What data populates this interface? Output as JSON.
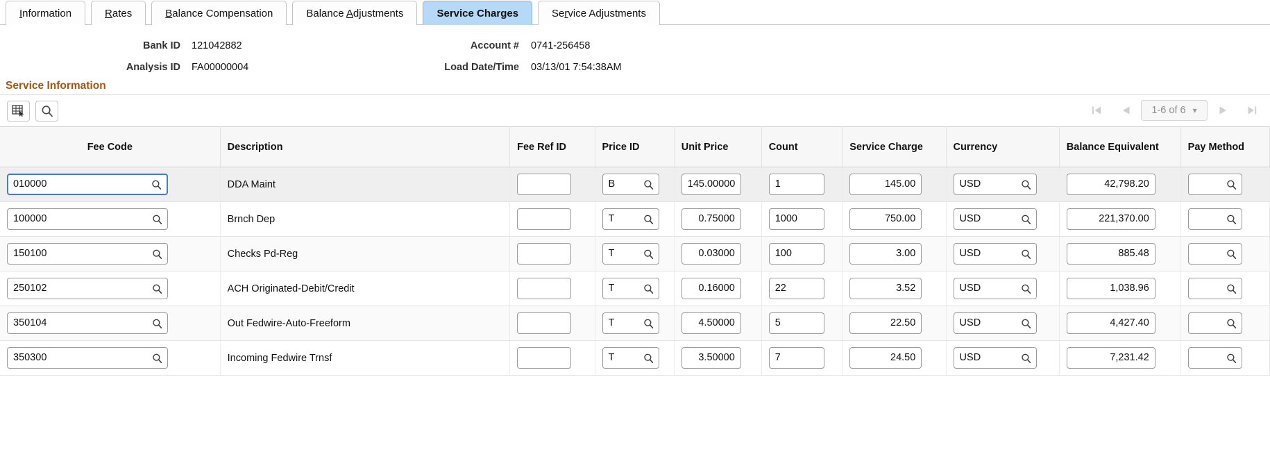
{
  "tabs": [
    {
      "label": "Information",
      "accel": "I",
      "active": false
    },
    {
      "label": "Rates",
      "accel": "R",
      "active": false
    },
    {
      "label": "Balance Compensation",
      "accel": "B",
      "active": false
    },
    {
      "label": "Balance Adjustments",
      "accel": "A",
      "active": false
    },
    {
      "label": "Service Charges",
      "accel": "",
      "active": true
    },
    {
      "label": "Service Adjustments",
      "accel": "r",
      "active": false
    }
  ],
  "header": {
    "bank_id_label": "Bank ID",
    "bank_id_value": "121042882",
    "analysis_id_label": "Analysis ID",
    "analysis_id_value": "FA00000004",
    "account_label": "Account #",
    "account_value": "0741-256458",
    "load_date_label": "Load Date/Time",
    "load_date_value": "03/13/01  7:54:38AM"
  },
  "section": {
    "title": "Service Information",
    "accent_color": "#a85412"
  },
  "toolbar": {
    "personalize_icon": "grid-personalize-icon",
    "find_icon": "search-icon"
  },
  "pager": {
    "first_icon": "first-page-icon",
    "prev_icon": "previous-page-icon",
    "range_label": "1-6 of 6",
    "chevron_icon": "chevron-down-icon",
    "next_icon": "next-page-icon",
    "last_icon": "last-page-icon"
  },
  "columns": [
    {
      "key": "fee_code",
      "label": "Fee Code",
      "align": "center"
    },
    {
      "key": "description",
      "label": "Description",
      "align": "left"
    },
    {
      "key": "fee_ref_id",
      "label": "Fee Ref ID",
      "align": "left"
    },
    {
      "key": "price_id",
      "label": "Price ID",
      "align": "left"
    },
    {
      "key": "unit_price",
      "label": "Unit Price",
      "align": "left"
    },
    {
      "key": "count",
      "label": "Count",
      "align": "left"
    },
    {
      "key": "service_charge",
      "label": "Service Charge",
      "align": "left"
    },
    {
      "key": "currency",
      "label": "Currency",
      "align": "left"
    },
    {
      "key": "balance_equivalent",
      "label": "Balance Equivalent",
      "align": "left"
    },
    {
      "key": "pay_method",
      "label": "Pay Method",
      "align": "left"
    }
  ],
  "rows": [
    {
      "fee_code": "010000",
      "description": "DDA Maint",
      "fee_ref_id": "",
      "price_id": "B",
      "unit_price": "145.00000",
      "count": "1",
      "service_charge": "145.00",
      "currency": "USD",
      "balance_equivalent": "42,798.20",
      "pay_method": ""
    },
    {
      "fee_code": "100000",
      "description": "Brnch Dep",
      "fee_ref_id": "",
      "price_id": "T",
      "unit_price": "0.75000",
      "count": "1000",
      "service_charge": "750.00",
      "currency": "USD",
      "balance_equivalent": "221,370.00",
      "pay_method": ""
    },
    {
      "fee_code": "150100",
      "description": "Checks Pd-Reg",
      "fee_ref_id": "",
      "price_id": "T",
      "unit_price": "0.03000",
      "count": "100",
      "service_charge": "3.00",
      "currency": "USD",
      "balance_equivalent": "885.48",
      "pay_method": ""
    },
    {
      "fee_code": "250102",
      "description": "ACH Originated-Debit/Credit",
      "fee_ref_id": "",
      "price_id": "T",
      "unit_price": "0.16000",
      "count": "22",
      "service_charge": "3.52",
      "currency": "USD",
      "balance_equivalent": "1,038.96",
      "pay_method": ""
    },
    {
      "fee_code": "350104",
      "description": "Out Fedwire-Auto-Freeform",
      "fee_ref_id": "",
      "price_id": "T",
      "unit_price": "4.50000",
      "count": "5",
      "service_charge": "22.50",
      "currency": "USD",
      "balance_equivalent": "4,427.40",
      "pay_method": ""
    },
    {
      "fee_code": "350300",
      "description": "Incoming Fedwire Trnsf",
      "fee_ref_id": "",
      "price_id": "T",
      "unit_price": "3.50000",
      "count": "7",
      "service_charge": "24.50",
      "currency": "USD",
      "balance_equivalent": "7,231.42",
      "pay_method": ""
    }
  ],
  "icons": {
    "lookup": "search-icon"
  }
}
